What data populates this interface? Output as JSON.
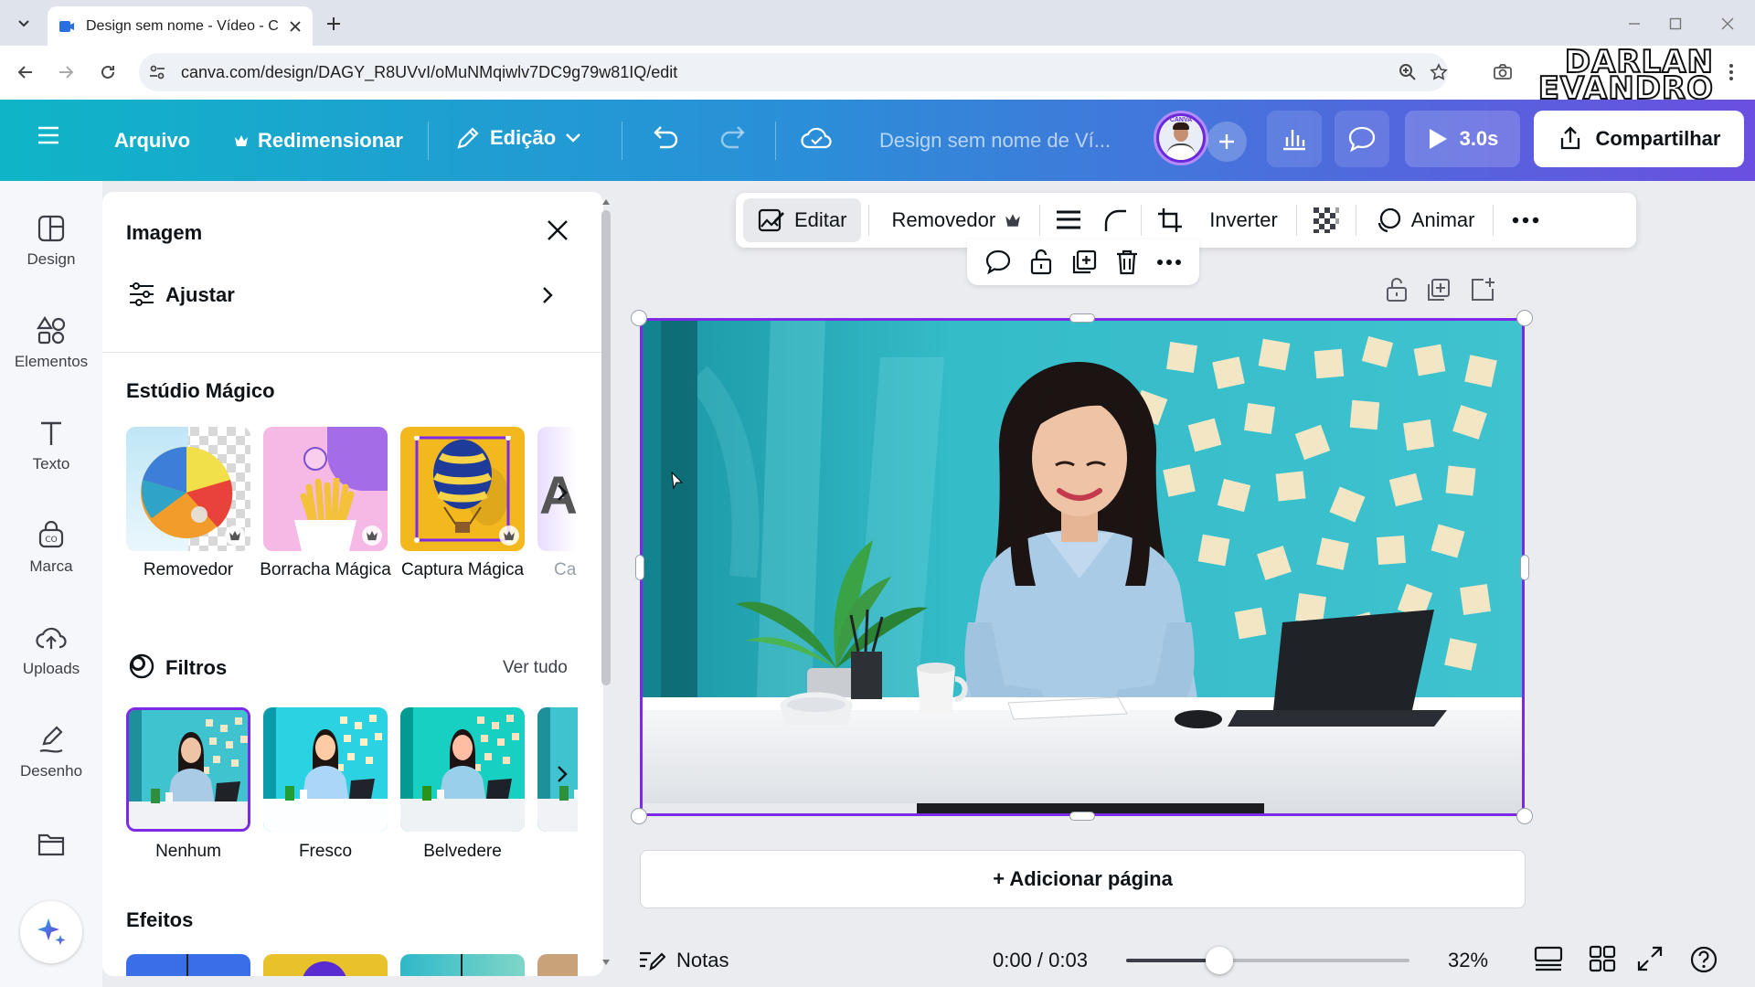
{
  "browser": {
    "tab_title": "Design sem nome - Vídeo - Canva",
    "url": "canva.com/design/DAGY_R8UVvI/oMuNMqiwlv7DC9g79w81IQ/edit",
    "watermark_line1": "DARLAN",
    "watermark_line2": "EVANDRO"
  },
  "header": {
    "menu_icon": "hamburger-icon",
    "file_label": "Arquivo",
    "resize_label": "Redimensionar",
    "edit_label": "Edição",
    "design_title": "Design sem nome de Ví...",
    "avatar_badge": "CANVA",
    "play_duration": "3.0s",
    "share_label": "Compartilhar"
  },
  "rail": {
    "items": [
      {
        "label": "Design",
        "icon": "layout-icon"
      },
      {
        "label": "Elementos",
        "icon": "shapes-icon"
      },
      {
        "label": "Texto",
        "icon": "text-icon"
      },
      {
        "label": "Marca",
        "icon": "brand-icon"
      },
      {
        "label": "Uploads",
        "icon": "cloud-upload-icon"
      },
      {
        "label": "Desenho",
        "icon": "draw-icon"
      }
    ]
  },
  "panel": {
    "title": "Imagem",
    "adjust_label": "Ajustar",
    "magic_studio_title": "Estúdio Mágico",
    "magic_tools": [
      {
        "label": "Removedor"
      },
      {
        "label": "Borracha Mágica"
      },
      {
        "label": "Captura Mágica"
      },
      {
        "label": "Ca"
      }
    ],
    "filters_title": "Filtros",
    "filters_see_all": "Ver tudo",
    "filters": [
      {
        "label": "Nenhum"
      },
      {
        "label": "Fresco"
      },
      {
        "label": "Belvedere"
      }
    ],
    "effects_title": "Efeitos"
  },
  "toolbar": {
    "edit_label": "Editar",
    "remover_label": "Removedor",
    "flip_label": "Inverter",
    "animate_label": "Animar"
  },
  "canvas": {
    "add_page_label": "+ Adicionar página"
  },
  "footer": {
    "notes_label": "Notas",
    "time": "0:00 / 0:03",
    "timeline_position": 0.33,
    "zoom": "32%"
  },
  "colors": {
    "accent": "#7d2ae8",
    "header_start": "#0fb5c7",
    "header_end": "#6a4fe0"
  }
}
